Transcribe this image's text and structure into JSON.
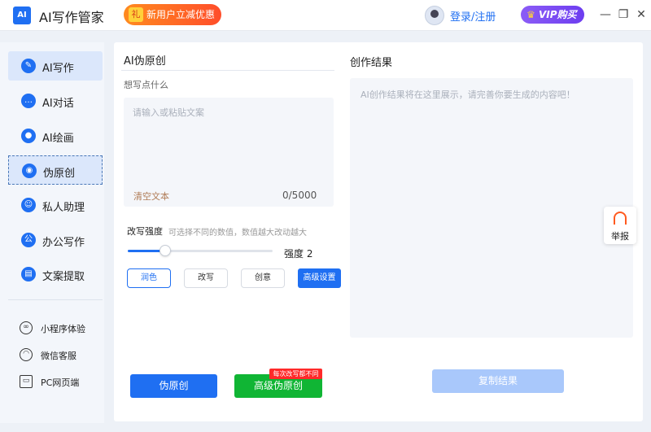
{
  "app": {
    "logo_text": "AI",
    "title": "AI写作管家"
  },
  "header": {
    "promo_label": "新用户立减优惠",
    "login_label": "登录/注册",
    "vip_label": "VIP购买",
    "win_min": "—",
    "win_max": "❐",
    "win_close": "✕"
  },
  "sidebar": {
    "items": [
      {
        "label": "AI写作",
        "icon": "pen-icon"
      },
      {
        "label": "AI对话",
        "icon": "chat-icon"
      },
      {
        "label": "AI绘画",
        "icon": "palette-icon"
      },
      {
        "label": "伪原创",
        "icon": "location-pin-icon"
      },
      {
        "label": "私人助理",
        "icon": "assistant-icon"
      },
      {
        "label": "办公写作",
        "icon": "office-icon"
      },
      {
        "label": "文案提取",
        "icon": "extract-icon"
      }
    ],
    "bottom": [
      {
        "label": "小程序体验",
        "icon": "mini-program-icon"
      },
      {
        "label": "微信客服",
        "icon": "wechat-service-icon"
      },
      {
        "label": "PC网页端",
        "icon": "pc-web-icon"
      }
    ]
  },
  "left_panel": {
    "title": "AI伪原创",
    "hint": "想写点什么",
    "input_placeholder": "请输入或粘贴文案",
    "input_value": "",
    "clear_label": "清空文本",
    "counter": "0/5000",
    "strength_label": "改写强度",
    "strength_tip": "可选择不同的数值，数值越大改动越大",
    "strength_value_label": "强度 2",
    "strength_level": 0.26,
    "modes": [
      "润色",
      "改写",
      "创意"
    ],
    "active_mode": "润色",
    "advanced_settings": "高级设置"
  },
  "right_panel": {
    "title": "创作结果",
    "placeholder": "AI创作结果将在这里展示，请完善你要生成的内容吧！"
  },
  "actions": {
    "pseudo_original": "伪原创",
    "advanced_pseudo_original": "高级伪原创",
    "advanced_tag": "每次改写都不同",
    "copy_result": "复制结果"
  },
  "report": {
    "label": "举报"
  },
  "colors": {
    "primary": "#1f6ff2",
    "green": "#10b534",
    "red_tag": "#ff2a2a",
    "disabled": "#a9c8fb"
  }
}
